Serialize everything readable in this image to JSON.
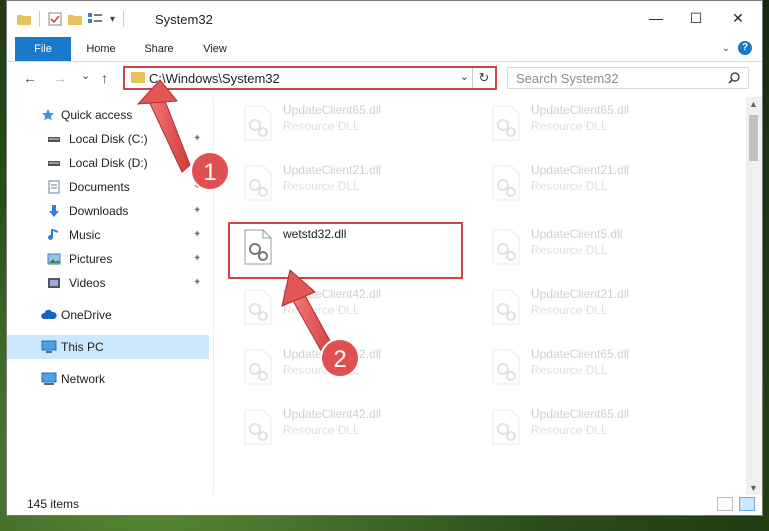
{
  "window": {
    "title": "System32",
    "controls": {
      "minimize": "—",
      "maximize": "☐",
      "close": "✕"
    }
  },
  "ribbon": {
    "tabs": [
      "File",
      "Home",
      "Share",
      "View"
    ],
    "help": "?"
  },
  "navigation": {
    "back": "←",
    "forward": "→",
    "recent": "⌄",
    "up": "↑",
    "address_path": "C:\\Windows\\System32",
    "refresh": "↻",
    "search_placeholder": "Search System32",
    "search_icon": "search-icon"
  },
  "sidebar": {
    "items": [
      {
        "label": "Quick access",
        "icon": "star-icon",
        "pinned": false
      },
      {
        "label": "Local Disk (C:)",
        "icon": "drive-icon",
        "pinned": true
      },
      {
        "label": "Local Disk (D:)",
        "icon": "drive-icon",
        "pinned": false
      },
      {
        "label": "Documents",
        "icon": "documents-icon",
        "pinned": true
      },
      {
        "label": "Downloads",
        "icon": "download-icon",
        "pinned": true
      },
      {
        "label": "Music",
        "icon": "music-icon",
        "pinned": true
      },
      {
        "label": "Pictures",
        "icon": "pictures-icon",
        "pinned": true
      },
      {
        "label": "Videos",
        "icon": "videos-icon",
        "pinned": true
      },
      {
        "label": "OneDrive",
        "icon": "cloud-icon",
        "pinned": false
      },
      {
        "label": "This PC",
        "icon": "pc-icon",
        "pinned": false,
        "selected": true
      },
      {
        "label": "Network",
        "icon": "network-icon",
        "pinned": false
      }
    ],
    "pin_glyph": "📌"
  },
  "files": {
    "left_column": [
      {
        "name": "UpdateClient65.dll",
        "type": "Resource DLL",
        "faded": true
      },
      {
        "name": "UpdateClient21.dll",
        "type": "Resource DLL",
        "faded": true
      },
      {
        "name": "wetstd32.dll",
        "type": "",
        "faded": false
      },
      {
        "name": "UpdateClient42.dll",
        "type": "Resource DLL",
        "faded": true
      },
      {
        "name": "UpdateClient42.dll",
        "type": "Resource DLL",
        "faded": true
      },
      {
        "name": "UpdateClient42.dll",
        "type": "Resource DLL",
        "faded": true
      }
    ],
    "right_column": [
      {
        "name": "UpdateClient65.dll",
        "type": "Resource DLL",
        "faded": true
      },
      {
        "name": "UpdateClient21.dll",
        "type": "Resource DLL",
        "faded": true
      },
      {
        "name": "UpdateClient5.dll",
        "type": "Resource DLL",
        "faded": true
      },
      {
        "name": "UpdateClient21.dll",
        "type": "Resource DLL",
        "faded": true
      },
      {
        "name": "UpdateClient65.dll",
        "type": "Resource DLL",
        "faded": true
      },
      {
        "name": "UpdateClient65.dll",
        "type": "Resource DLL",
        "faded": true
      }
    ]
  },
  "status_bar": {
    "item_count": "145 items"
  },
  "annotations": {
    "step1": "1",
    "step2": "2",
    "accent_color": "#d24444"
  }
}
